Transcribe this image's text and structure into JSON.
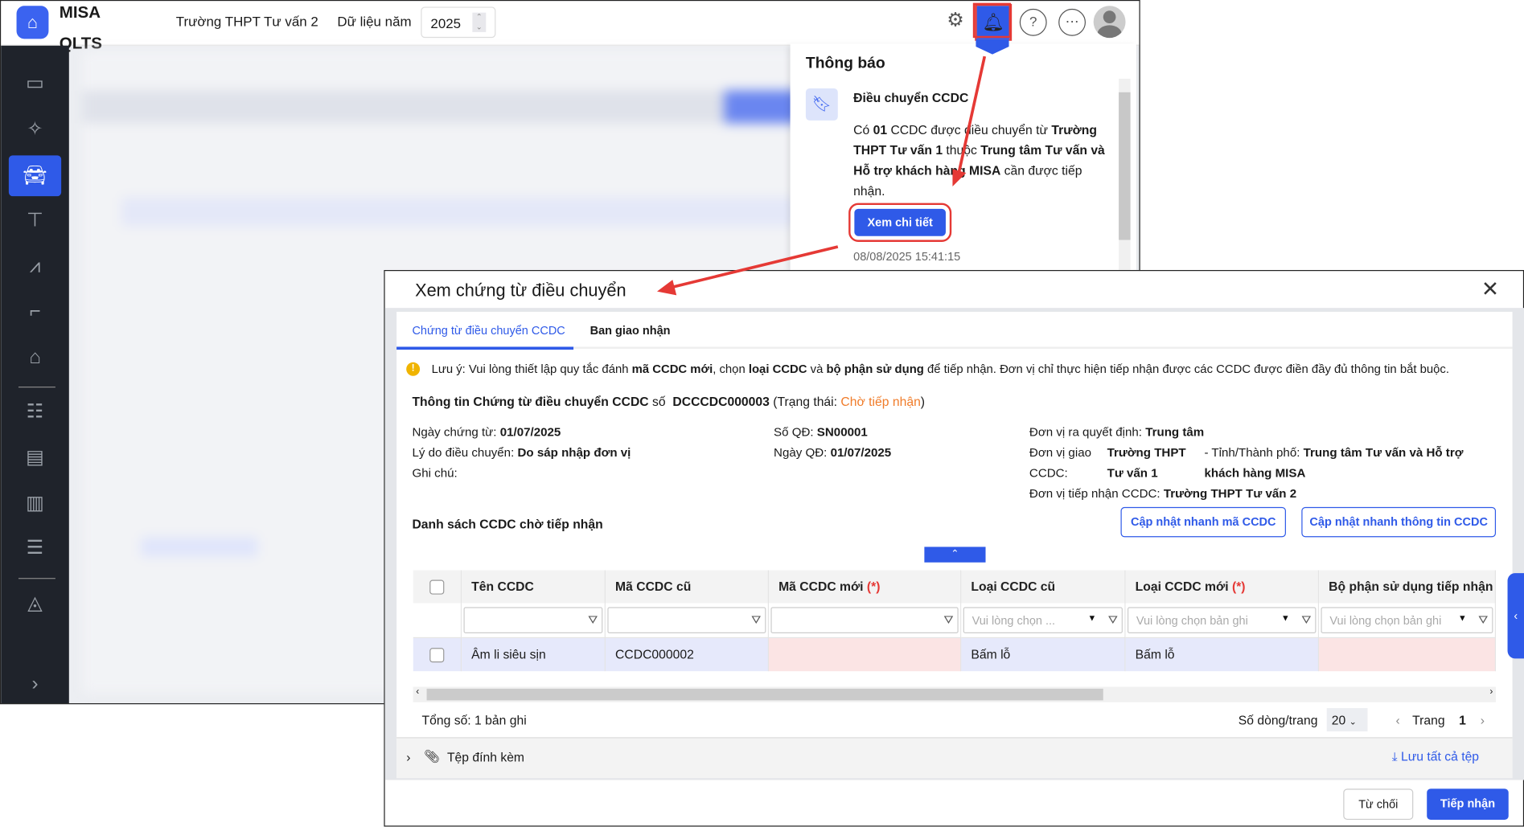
{
  "header": {
    "brand": "MISA QLTS",
    "unit": "Trường THPT Tư vấn 2",
    "year_label": "Dữ liệu năm",
    "year": "2025"
  },
  "notifications": {
    "title": "Thông báo",
    "item": {
      "title": "Điều chuyển CCDC",
      "body_parts": [
        "Có ",
        "01",
        " CCDC được điều chuyển từ ",
        "Trường THPT Tư vấn 1",
        " thuộc ",
        "Trung tâm Tư vấn và Hỗ trợ khách hàng MISA",
        " cần được tiếp nhận."
      ],
      "button": "Xem chi tiết",
      "time": "08/08/2025 15:41:15"
    }
  },
  "modal": {
    "title": "Xem chứng từ điều chuyển",
    "tabs": [
      "Chứng từ điều chuyển CCDC",
      "Ban giao nhận"
    ],
    "notice": {
      "p1": "Lưu ý: Vui lòng thiết lập quy tắc đánh ",
      "b1": "mã CCDC mới",
      ",": ", chọn ",
      "b2": "loại CCDC",
      "p2": " và ",
      "b3": "bộ phận sử dụng",
      "p3": " để tiếp nhận. Đơn vị chỉ thực hiện tiếp nhận được các CCDC được điền đầy đủ thông tin bắt buộc."
    },
    "info": {
      "heading": "Thông tin Chứng từ điều chuyển CCDC",
      "so_label": "số",
      "doc_no": "DCCCDC000003",
      "status_open": "(Trạng thái: ",
      "status": "Chờ tiếp nhận",
      "status_close": ")",
      "ngay_ct_label": "Ngày chứng từ:",
      "ngay_ct": "01/07/2025",
      "ly_do_label": "Lý do điều chuyển:",
      "ly_do": "Do sáp nhập đơn vị",
      "ghi_chu_label": "Ghi chú:",
      "so_qd_label": "Số QĐ:",
      "so_qd": "SN00001",
      "ngay_qd_label": "Ngày QĐ:",
      "ngay_qd": "01/07/2025",
      "dv_qd_label": "Đơn vị ra quyết định:",
      "dv_qd": "Trung tâm",
      "dv_giao_label": "Đơn vị giao CCDC:",
      "dv_giao": "Trường THPT Tư vấn 1",
      "tinh_label": "- Tỉnh/Thành phố:",
      "tinh": "Trung tâm Tư vấn và Hỗ trợ khách hàng MISA",
      "dv_nhan_label": "Đơn vị tiếp nhận CCDC:",
      "dv_nhan": "Trường THPT Tư vấn 2"
    },
    "list_title": "Danh sách CCDC chờ tiếp nhận",
    "btn_update_code": "Cập nhật nhanh mã CCDC",
    "btn_update_info": "Cập nhật nhanh thông tin CCDC",
    "columns": [
      "Tên CCDC",
      "Mã CCDC cũ",
      "Mã CCDC mới",
      "Loại CCDC cũ",
      "Loại CCDC mới",
      "Bộ phận sử dụng tiếp nhận"
    ],
    "required_mark": "(*)",
    "filter_placeholders": {
      "loai_cu": "Vui lòng chọn ...",
      "loai_moi": "Vui lòng chọn bản ghi",
      "bo_phan": "Vui lòng chọn bản ghi"
    },
    "rows": [
      {
        "ten": "Âm li siêu sịn",
        "ma_cu": "CCDC000002",
        "ma_moi": "",
        "loai_cu": "Bấm lỗ",
        "loai_moi": "Bấm lỗ",
        "bo_phan": ""
      }
    ],
    "total": "Tổng số: 1 bản ghi",
    "page_size_label": "Số dòng/trang",
    "page_size": "20",
    "page_label": "Trang",
    "page": "1",
    "attach_label": "Tệp đính kèm",
    "save_all": "Lưu tất cả tệp",
    "reject": "Từ chối",
    "accept": "Tiếp nhận"
  },
  "colors": {
    "accent": "#2f5ae8",
    "status": "#f07c2a",
    "annotation": "#e53935"
  }
}
